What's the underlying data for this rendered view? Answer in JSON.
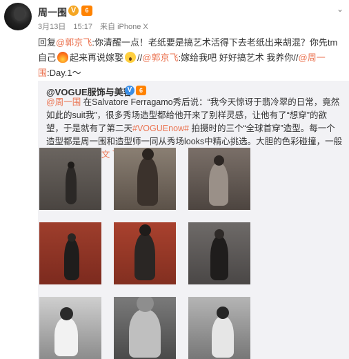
{
  "post": {
    "author": "周一围",
    "verify_badge": "V",
    "vip_badge": "6",
    "date": "3月13日",
    "time": "15:17",
    "source": "来自 iPhone X",
    "more_icon": "chevron-down-icon",
    "text_segments": [
      {
        "t": "text",
        "v": "回复"
      },
      {
        "t": "mention",
        "v": "@郭京飞"
      },
      {
        "t": "text",
        "v": ":你清醒一点！老纸要是搞艺术活得下去老纸出来胡混？你先tm自己"
      },
      {
        "t": "emoji",
        "v": "fire"
      },
      {
        "t": "text",
        "v": "起来再说嫁娶"
      },
      {
        "t": "emoji",
        "v": "shock"
      },
      {
        "t": "text",
        "v": "//"
      },
      {
        "t": "mention",
        "v": "@郭京飞"
      },
      {
        "t": "text",
        "v": ":嫁给我吧 好好搞艺术 我养你//"
      },
      {
        "t": "mention",
        "v": "@周一围"
      },
      {
        "t": "text",
        "v": ":Day.1～"
      }
    ]
  },
  "repost": {
    "author": "@VOGUE服饰与美容",
    "verify_badge": "V",
    "vip_badge": "6",
    "text_segments": [
      {
        "t": "mention",
        "v": "@周一围"
      },
      {
        "t": "text",
        "v": " 在Salvatore Ferragamo秀后说：“我今天惊讶于翡冷翠的日常，竟然如此的suit我”，很多秀场造型都给他开来了别样灵感，让他有了“想穿”的欲望，于是就有了第二天"
      },
      {
        "t": "hashtag",
        "v": "#VOGUEnow#"
      },
      {
        "t": "text",
        "v": " 拍摄时的三个“全球首穿”造型。每一个造型都是周一围和造型师一同从秀场looks中精心挑选。大胆的色彩碰撞，一般人不 ..."
      },
      {
        "t": "link",
        "v": " 展开全文 ﹀"
      }
    ]
  },
  "photos": [
    {
      "label": "street-portrait-1"
    },
    {
      "label": "street-portrait-2"
    },
    {
      "label": "street-portrait-3"
    },
    {
      "label": "red-wall-portrait-1"
    },
    {
      "label": "red-wall-portrait-2"
    },
    {
      "label": "red-wall-portrait-3"
    },
    {
      "label": "bw-portrait-1"
    },
    {
      "label": "bw-portrait-flower"
    },
    {
      "label": "bw-portrait-3"
    }
  ],
  "colors": {
    "link": "#eb7350",
    "repost_bg": "#f2f2f5"
  }
}
